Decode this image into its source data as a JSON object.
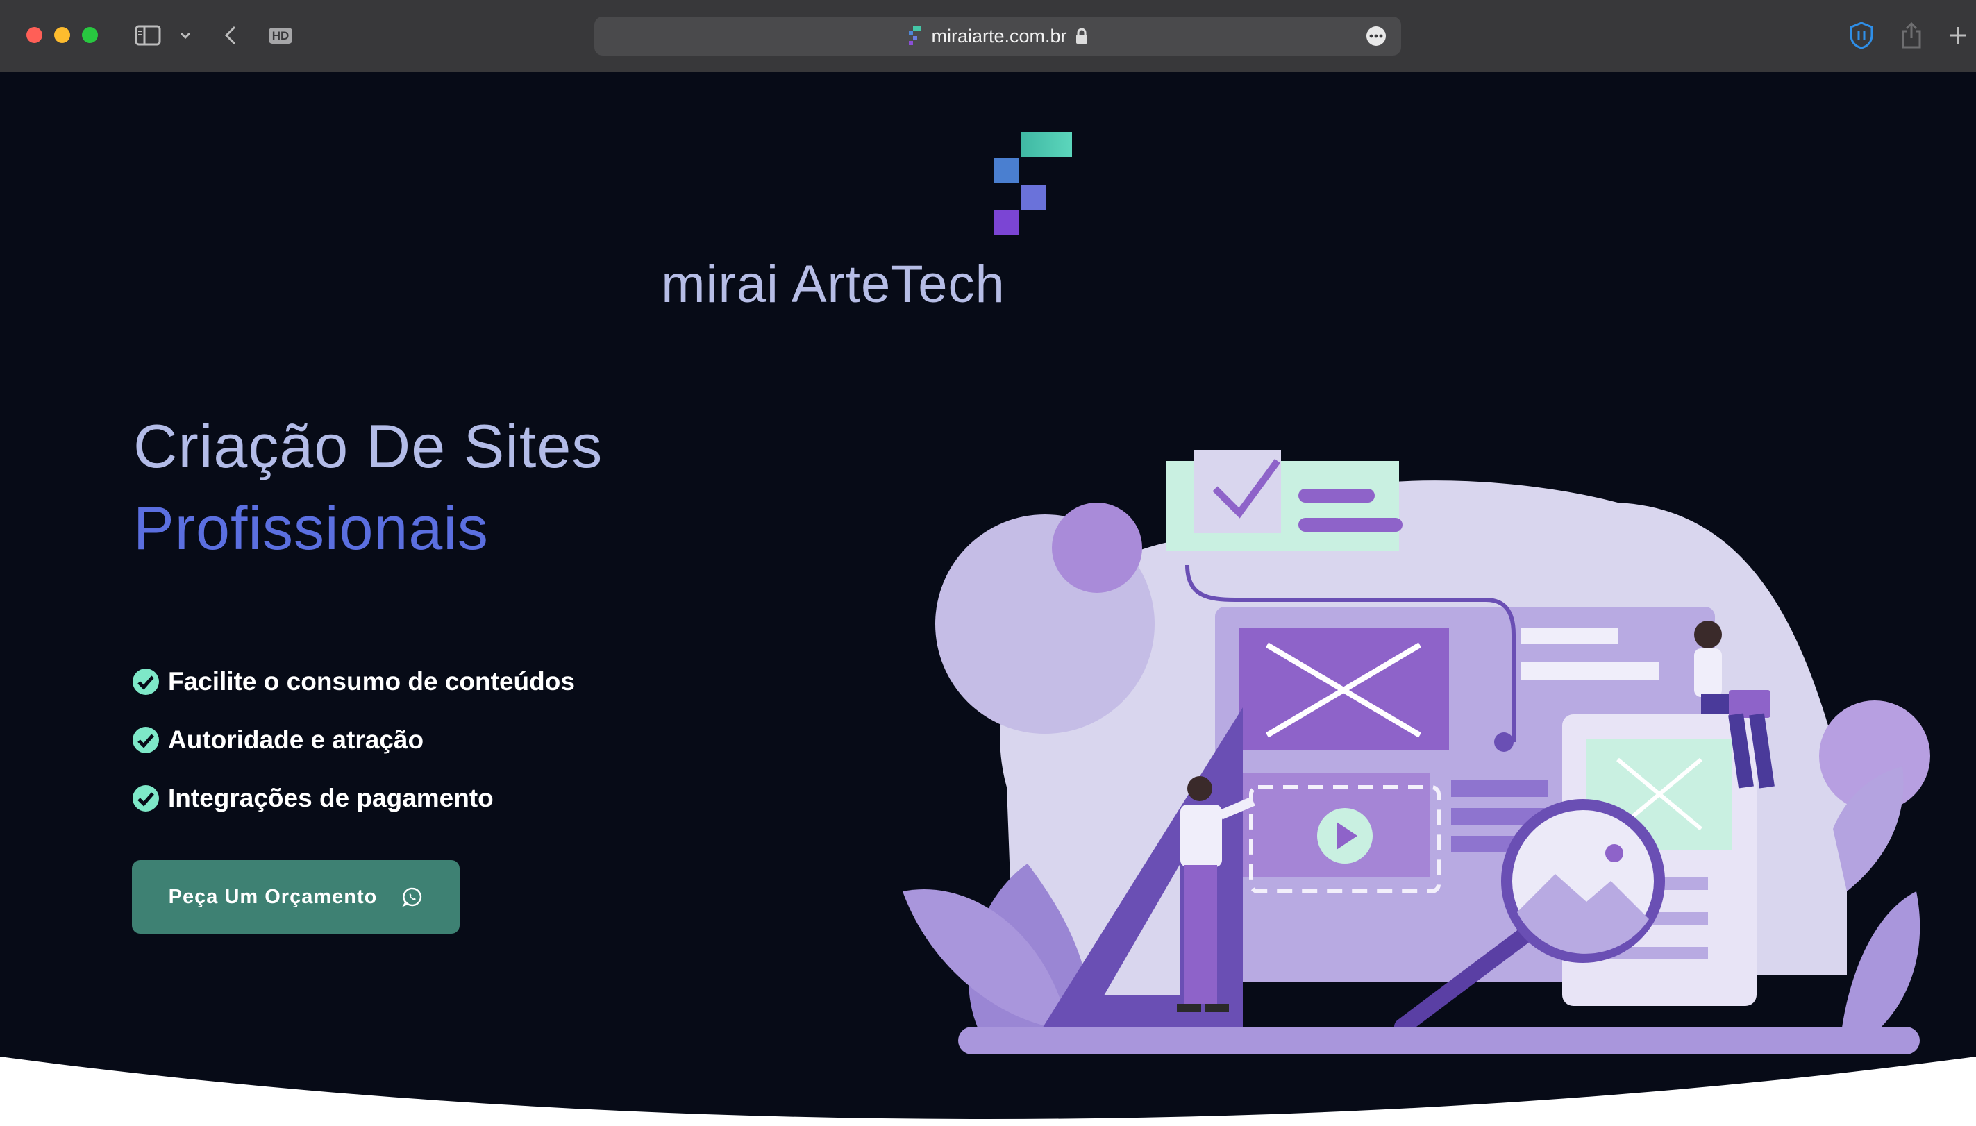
{
  "browser": {
    "url": "miraiarte.com.br",
    "hd_label": "HD"
  },
  "brand": {
    "name": "mirai ArteTech"
  },
  "hero": {
    "title_line1": "Criação De Sites",
    "title_line2": "Profissionais",
    "features": [
      "Facilite o consumo de conteúdos",
      "Autoridade e atração",
      "Integrações de pagamento"
    ],
    "cta_label": "Peça Um Orçamento",
    "cta_icon": "whatsapp-icon"
  },
  "colors": {
    "page_bg": "#070b17",
    "title_light": "#b3bce8",
    "title_accent": "#5b6fe0",
    "cta_bg": "#3e8173",
    "check": "#7ee8c8",
    "illustration_purple": "#8e63c9",
    "illustration_mint": "#bfe9da"
  }
}
